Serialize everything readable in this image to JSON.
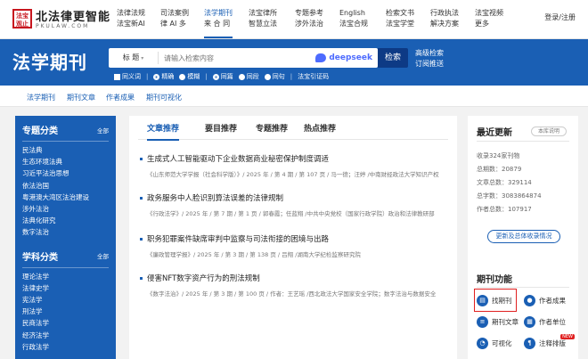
{
  "logo": {
    "seal": "法宝观止",
    "cn": "北法律更智能",
    "en": "PKULAW.COM"
  },
  "nav": [
    {
      "l1": "法律法规",
      "l2": "法宝新AI"
    },
    {
      "l1": "司法案例",
      "l2": "律 AI 多"
    },
    {
      "l1": "法学期刊",
      "l2": "来 合 同"
    },
    {
      "l1": "法宝律所",
      "l2": "智慧立法"
    },
    {
      "l1": "专题参考",
      "l2": "涉外法治"
    },
    {
      "l1": "English",
      "l2": "法宝合规"
    },
    {
      "l1": "检索文书",
      "l2": "法宝学堂"
    },
    {
      "l1": "行政执法",
      "l2": "解决方案"
    },
    {
      "l1": "法宝视频",
      "l2": "更多"
    }
  ],
  "login": "登录/注册",
  "header": {
    "title": "法学期刊",
    "scope": "标 题",
    "placeholder": "请输入检索内容",
    "deepseek": "deepseek",
    "search": "检索",
    "adv1": "高级检索",
    "adv2": "订阅推送"
  },
  "options": [
    "同义词",
    "精确",
    "模糊",
    "同篇",
    "同段",
    "同句",
    "法宝引证码"
  ],
  "subnav": [
    "法学期刊",
    "期刊文章",
    "作者成果",
    "期刊可视化"
  ],
  "left": {
    "topic_title": "专题分类",
    "topic_all": "全部",
    "topics": [
      "民法典",
      "生态环境法典",
      "习近平法治思想",
      "依法治国",
      "粤港澳大湾区法治建设",
      "涉外法治",
      "法典化研究",
      "数字法治"
    ],
    "subject_title": "学科分类",
    "subject_all": "全部",
    "subjects": [
      "理论法学",
      "法律史学",
      "宪法学",
      "刑法学",
      "民商法学",
      "经济法学",
      "行政法学"
    ]
  },
  "tabs": [
    "文章推荐",
    "要目推荐",
    "专题推荐",
    "热点推荐"
  ],
  "articles": [
    {
      "title": "生成式人工智能驱动下企业数据商业秘密保护制度调适",
      "meta": "《山东师范大学学报（社会科学版）》/ 2025 年 / 第 4 期 / 第 107 页 / 马一德；汪婷 /中南财经政法大学知识产权"
    },
    {
      "title": "政务服务中人脸识别算法误差的法律规制",
      "meta": "《行政法学》/ 2025 年 / 第 7 期 / 第 1 页 / 郭春霞；任蓝翔 /中共中央党校（国家行政学院）政治和法律教研部"
    },
    {
      "title": "职务犯罪案件缺席审判中监察与司法衔接的困境与出路",
      "meta": "《廉政管理学报》/ 2025 年 / 第 3 期 / 第 138 页 / 吕翔 /湖南大学纪检监察研究院"
    },
    {
      "title": "侵害NFT数字资产行为的刑法规制",
      "meta": "《数字法治》/ 2025 年 / 第 3 期 / 第 100 页 / 作者：王艺瑶 /西北政法大学国家安全学院；数字法治与数据安全"
    }
  ],
  "right": {
    "latest_title": "最近更新",
    "intro": "本库说明",
    "stats": [
      "收录324家刊物",
      "总期数：20879",
      "文章总数：329114",
      "总字数：3083864874",
      "作者总数：107917"
    ],
    "full_button": "更新及总体收录情况",
    "func_title": "期刊功能",
    "funcs": [
      "找期刊",
      "作者成果",
      "期刊文章",
      "作者单位",
      "可视化",
      "注释排版"
    ],
    "new_badge": "NEW"
  },
  "colors": {
    "primary": "#1a5fb4",
    "dark": "#0d3a85",
    "red": "#e02020"
  }
}
